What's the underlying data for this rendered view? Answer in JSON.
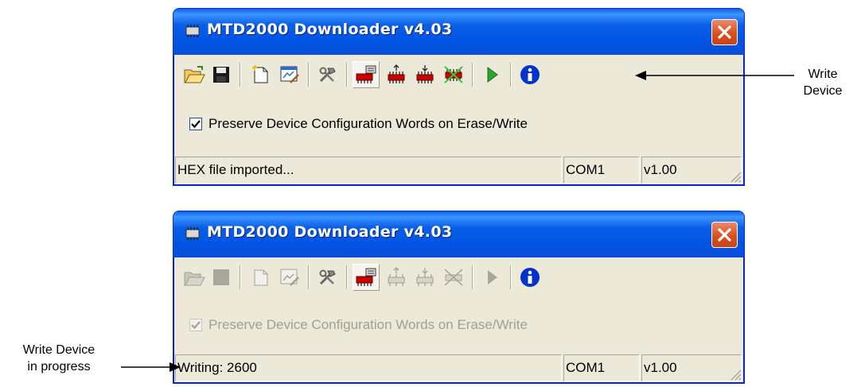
{
  "windows": [
    {
      "title": "MTD2000 Downloader v4.03",
      "enabled": true,
      "checkbox_label": "Preserve Device Configuration Words on Erase/Write",
      "checkbox_checked": true,
      "status": {
        "message": "HEX file imported...",
        "port": "COM1",
        "version": "v1.00"
      }
    },
    {
      "title": "MTD2000 Downloader v4.03",
      "enabled": false,
      "checkbox_label": "Preserve Device Configuration Words on Erase/Write",
      "checkbox_checked": true,
      "status": {
        "message": "Writing: 2600",
        "port": "COM1",
        "version": "v1.00"
      }
    }
  ],
  "toolbar_icons": [
    "open-folder-icon",
    "save-icon",
    "new-document-icon",
    "edit-data-icon",
    "tools-icon",
    "device-select-icon",
    "read-device-icon",
    "write-device-icon",
    "erase-device-icon",
    "run-icon",
    "info-icon"
  ],
  "callouts": {
    "write_device": [
      "Write",
      "Device"
    ],
    "write_in_progress": [
      "Write Device",
      "in progress"
    ]
  },
  "colors": {
    "titlebar": "#0054e3",
    "window_bg": "#ece9d8",
    "close_button": "#d9501e",
    "chip_red": "#cc0000",
    "run_green": "#2aa62a",
    "info_blue": "#0033cc"
  }
}
